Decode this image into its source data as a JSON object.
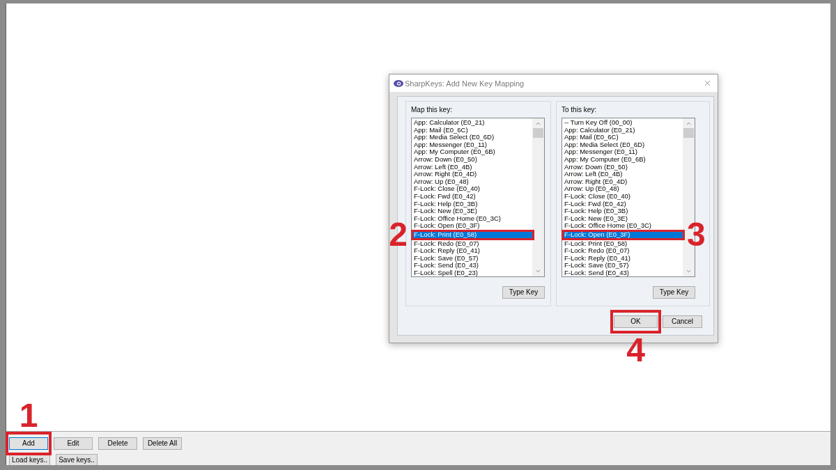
{
  "main_window": {
    "toolbar_rows": [
      [
        {
          "label": "Add",
          "focused": true,
          "callout": "1"
        },
        {
          "label": "Edit",
          "focused": false
        },
        {
          "label": "Delete",
          "focused": false
        },
        {
          "label": "Delete All",
          "focused": false
        }
      ],
      [
        {
          "label": "Load keys..",
          "focused": false
        },
        {
          "label": "Save keys..",
          "focused": false
        }
      ]
    ]
  },
  "dialog": {
    "title": "SharpKeys: Add New Key Mapping",
    "panels": [
      {
        "label": "Map this key:",
        "items": [
          {
            "label": "App: Calculator (E0_21)",
            "selected": false
          },
          {
            "label": "App: Mail (E0_6C)",
            "selected": false
          },
          {
            "label": "App: Media Select (E0_6D)",
            "selected": false
          },
          {
            "label": "App: Messenger (E0_11)",
            "selected": false
          },
          {
            "label": "App: My Computer (E0_6B)",
            "selected": false
          },
          {
            "label": "Arrow: Down (E0_50)",
            "selected": false
          },
          {
            "label": "Arrow: Left (E0_4B)",
            "selected": false
          },
          {
            "label": "Arrow: Right (E0_4D)",
            "selected": false
          },
          {
            "label": "Arrow: Up (E0_48)",
            "selected": false
          },
          {
            "label": "F-Lock: Close (E0_40)",
            "selected": false
          },
          {
            "label": "F-Lock: Fwd (E0_42)",
            "selected": false
          },
          {
            "label": "F-Lock: Help (E0_3B)",
            "selected": false
          },
          {
            "label": "F-Lock: New (E0_3E)",
            "selected": false
          },
          {
            "label": "F-Lock: Office Home (E0_3C)",
            "selected": false
          },
          {
            "label": "F-Lock: Open (E0_3F)",
            "selected": false
          },
          {
            "label": "F-Lock: Print (E0_58)",
            "selected": true,
            "callout": "2"
          },
          {
            "label": "F-Lock: Redo (E0_07)",
            "selected": false
          },
          {
            "label": "F-Lock: Reply (E0_41)",
            "selected": false
          },
          {
            "label": "F-Lock: Save (E0_57)",
            "selected": false
          },
          {
            "label": "F-Lock: Send (E0_43)",
            "selected": false
          },
          {
            "label": "F-Lock: Spell (E0_23)",
            "selected": false
          }
        ],
        "button": "Type Key"
      },
      {
        "label": "To this key:",
        "items": [
          {
            "label": "-- Turn Key Off (00_00)",
            "selected": false
          },
          {
            "label": "App: Calculator (E0_21)",
            "selected": false
          },
          {
            "label": "App: Mail (E0_6C)",
            "selected": false
          },
          {
            "label": "App: Media Select (E0_6D)",
            "selected": false
          },
          {
            "label": "App: Messenger (E0_11)",
            "selected": false
          },
          {
            "label": "App: My Computer (E0_6B)",
            "selected": false
          },
          {
            "label": "Arrow: Down (E0_50)",
            "selected": false
          },
          {
            "label": "Arrow: Left (E0_4B)",
            "selected": false
          },
          {
            "label": "Arrow: Right (E0_4D)",
            "selected": false
          },
          {
            "label": "Arrow: Up (E0_48)",
            "selected": false
          },
          {
            "label": "F-Lock: Close (E0_40)",
            "selected": false
          },
          {
            "label": "F-Lock: Fwd (E0_42)",
            "selected": false
          },
          {
            "label": "F-Lock: Help (E0_3B)",
            "selected": false
          },
          {
            "label": "F-Lock: New (E0_3E)",
            "selected": false
          },
          {
            "label": "F-Lock: Office Home (E0_3C)",
            "selected": false
          },
          {
            "label": "F-Lock: Open (E0_3F)",
            "selected": true,
            "callout": "3"
          },
          {
            "label": "F-Lock: Print (E0_58)",
            "selected": false
          },
          {
            "label": "F-Lock: Redo (E0_07)",
            "selected": false
          },
          {
            "label": "F-Lock: Reply (E0_41)",
            "selected": false
          },
          {
            "label": "F-Lock: Save (E0_57)",
            "selected": false
          },
          {
            "label": "F-Lock: Send (E0_43)",
            "selected": false
          }
        ],
        "button": "Type Key"
      }
    ],
    "buttons": [
      {
        "label": "OK",
        "callout": "4"
      },
      {
        "label": "Cancel"
      }
    ]
  }
}
